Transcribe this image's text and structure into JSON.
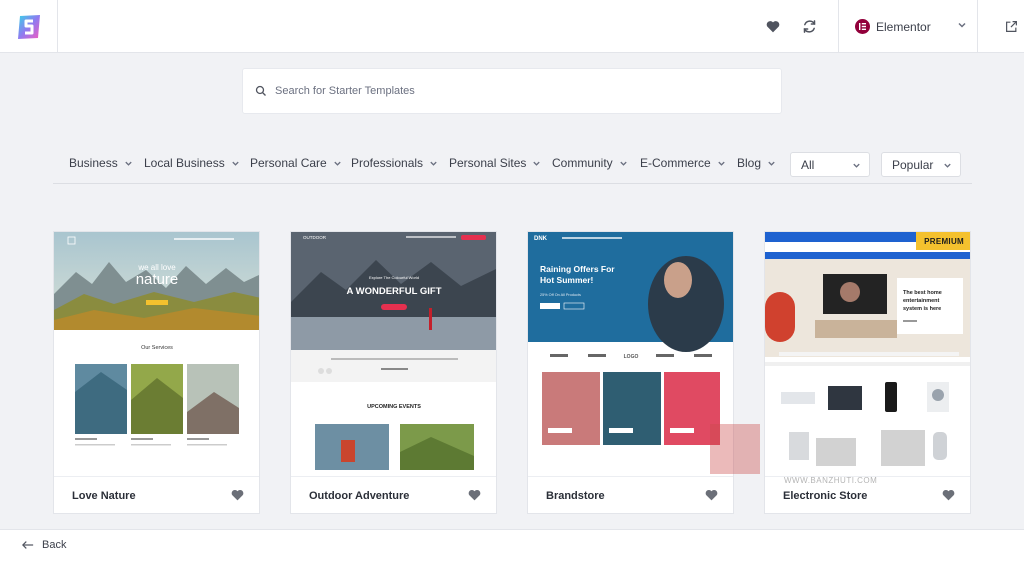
{
  "header": {
    "logo": "starter-templates-logo",
    "favorites_icon": "heart-icon",
    "sync_icon": "sync-icon",
    "builder": {
      "label": "Elementor",
      "icon": "elementor-icon"
    },
    "external_icon": "external-link-icon"
  },
  "search": {
    "placeholder": "Search for Starter Templates",
    "value": ""
  },
  "filters": {
    "categories": [
      {
        "label": "Business"
      },
      {
        "label": "Local Business"
      },
      {
        "label": "Personal Care"
      },
      {
        "label": "Professionals"
      },
      {
        "label": "Personal Sites"
      },
      {
        "label": "Community"
      },
      {
        "label": "E-Commerce"
      },
      {
        "label": "Blog"
      }
    ],
    "type_select": "All",
    "sort_select": "Popular"
  },
  "templates": [
    {
      "name": "Love Nature",
      "hero_line1": "we all love",
      "hero_line2": "nature",
      "section": "Our Services"
    },
    {
      "name": "Outdoor Adventure",
      "logo_text": "OUTDOOR",
      "kicker": "Explore The Colourful World",
      "hero": "A WONDERFUL GIFT",
      "section": "UPCOMING EVENTS"
    },
    {
      "name": "Brandstore",
      "logo_text": "DNK",
      "hero_line1": "Raining Offers For",
      "hero_line2": "Hot Summer!",
      "sub": "25% Off On All Products",
      "brand": "LOGO"
    },
    {
      "name": "Electronic Store",
      "badge": "PREMIUM",
      "hero_line1": "The best home",
      "hero_line2": "entertainment",
      "hero_line3": "system is here"
    }
  ],
  "colors": {
    "accent_red": "#e5304f",
    "premium": "#f4c12e",
    "elementor": "#92003b",
    "brandstore_blue": "#1f6d9e",
    "electronic_blue": "#1e62d0"
  },
  "footer": {
    "back_label": "Back",
    "back_icon": "arrow-left-icon"
  },
  "watermark": {
    "url": "WWW.BANZHUTI.COM"
  }
}
